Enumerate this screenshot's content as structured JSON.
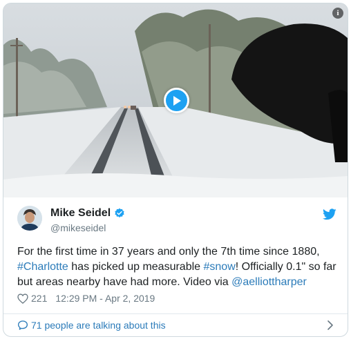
{
  "tweet": {
    "author_name": "Mike Seidel",
    "handle": "@mikeseidel",
    "text_parts": {
      "p1": "For the first time in 37 years and only the 7th time since 1880, ",
      "hashtag1": "#Charlotte",
      "p2": " has picked up measurable ",
      "hashtag2": "#snow",
      "p3": "!  Officially 0.1\" so far but areas nearby have had more.  Video via ",
      "mention": "@aelliottharper"
    },
    "likes": "221",
    "timestamp": "12:29 PM - Apr 2, 2019",
    "talking": "71 people are talking about this"
  },
  "icons": {
    "play": "play-icon",
    "info": "info-icon",
    "verified": "verified-badge-icon",
    "bird": "twitter-bird-icon",
    "heart": "heart-icon",
    "comment": "comment-bubble-icon",
    "chevron": "chevron-right-icon"
  },
  "colors": {
    "accent": "#1da1f2",
    "link": "#2b7bb9",
    "muted": "#697882",
    "text": "#1c2022",
    "border": "#cfd9de"
  }
}
